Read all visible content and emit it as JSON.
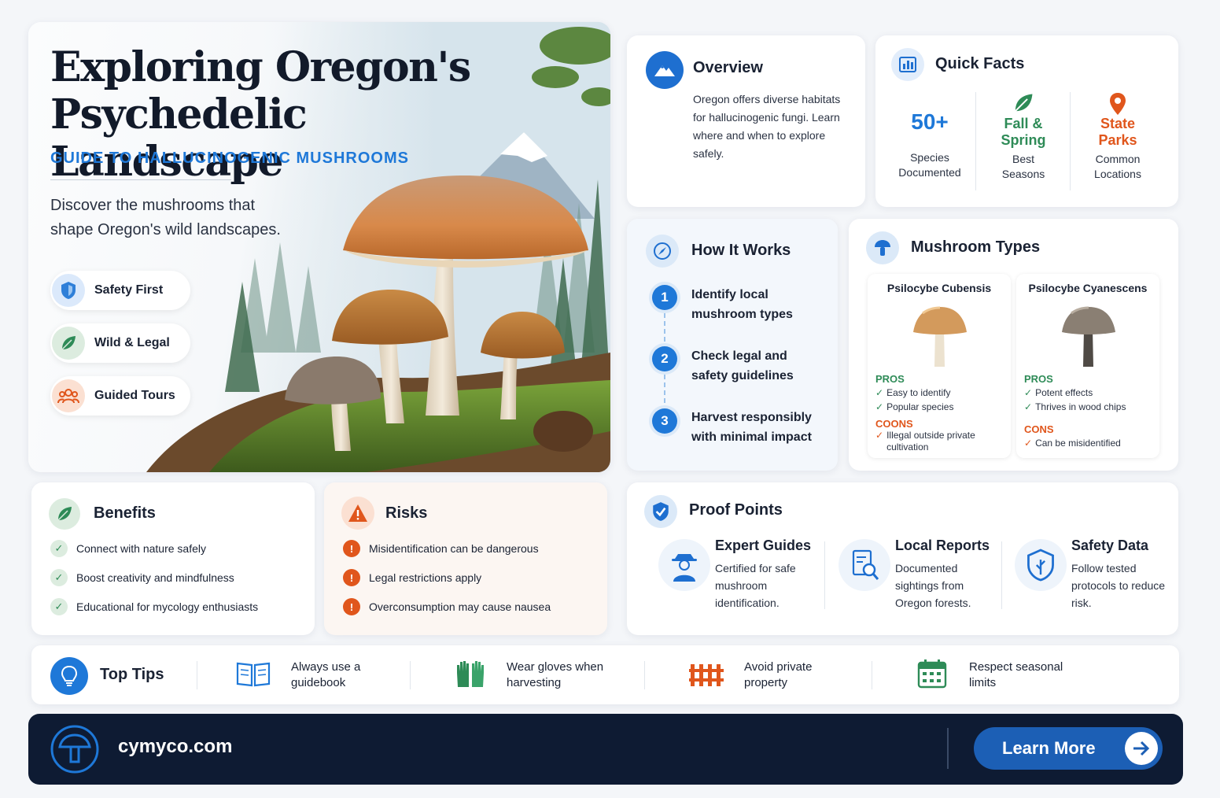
{
  "hero": {
    "title": "Exploring Oregon's Psychedelic Landscape",
    "subtitle": "GUIDE TO HALLUCINOGENIC MUSHROOMS",
    "description": "Discover the mushrooms that shape Oregon's wild landscapes.",
    "pills": [
      {
        "label": "Safety First",
        "icon": "shield-icon",
        "color": "#2f7fd8"
      },
      {
        "label": "Wild & Legal",
        "icon": "leaf-icon",
        "color": "#2e8b57"
      },
      {
        "label": "Guided Tours",
        "icon": "group-icon",
        "color": "#e0561c"
      }
    ]
  },
  "overview": {
    "title": "Overview",
    "icon": "mountain-icon",
    "text": "Oregon offers diverse habitats for hallucinogenic fungi. Learn where and when to explore safely."
  },
  "quick_facts": {
    "title": "Quick Facts",
    "icon": "bar-chart-icon",
    "items": [
      {
        "value": "50+",
        "label": "Species Documented",
        "color": "#1e78d8"
      },
      {
        "value": "Fall & Spring",
        "label": "Best Seasons",
        "icon": "leaf-icon",
        "color": "#2e8b57"
      },
      {
        "value": "State Parks",
        "label": "Common Locations",
        "icon": "map-pin-icon",
        "color": "#e0561c"
      }
    ]
  },
  "how_it_works": {
    "title": "How It Works",
    "icon": "compass-icon",
    "steps": [
      {
        "num": "1",
        "text": "Identify local mushroom types"
      },
      {
        "num": "2",
        "text": "Check legal and safety guidelines"
      },
      {
        "num": "3",
        "text": "Harvest responsibly with minimal impact"
      }
    ]
  },
  "mushroom_types": {
    "title": "Mushroom Types",
    "icon": "mushroom-icon",
    "pros_label": "PROS",
    "cons_label": "CONS",
    "cons_label_alt": "COONS",
    "types": [
      {
        "name": "Psilocybe Cubensis",
        "pros": [
          "Easy to identify",
          "Popular species"
        ],
        "cons": [
          "Illegal outside private cultivation"
        ]
      },
      {
        "name": "Psilocybe Cyanescens",
        "pros": [
          "Potent effects",
          "Thrives in wood chips"
        ],
        "cons": [
          "Can be misidentified"
        ]
      }
    ]
  },
  "benefits": {
    "title": "Benefits",
    "icon": "leaf-icon",
    "items": [
      "Connect with nature safely",
      "Boost creativity and mindfulness",
      "Educational for mycology enthusiasts"
    ]
  },
  "risks": {
    "title": "Risks",
    "icon": "warning-icon",
    "items": [
      "Misidentification can be dangerous",
      "Legal restrictions apply",
      "Overconsumption may cause nausea"
    ]
  },
  "proof_points": {
    "title": "Proof Points",
    "icon": "shield-check-icon",
    "items": [
      {
        "title": "Expert Guides",
        "text": "Certified for safe mushroom identification.",
        "icon": "ranger-icon"
      },
      {
        "title": "Local Reports",
        "text": "Documented sightings from Oregon forests.",
        "icon": "report-search-icon"
      },
      {
        "title": "Safety Data",
        "text": "Follow tested protocols to reduce risk.",
        "icon": "shield-leaf-icon"
      }
    ]
  },
  "top_tips": {
    "title": "Top Tips",
    "icon": "lightbulb-icon",
    "items": [
      {
        "text": "Always use a guidebook",
        "icon": "book-icon"
      },
      {
        "text": "Wear gloves when harvesting",
        "icon": "gloves-icon"
      },
      {
        "text": "Avoid private property",
        "icon": "fence-icon"
      },
      {
        "text": "Respect seasonal limits",
        "icon": "calendar-icon"
      }
    ]
  },
  "footer": {
    "site": "cymyco.com",
    "cta": "Learn More",
    "logo_icon": "mushroom-logo-icon",
    "arrow_icon": "arrow-right-icon"
  },
  "colors": {
    "accent_blue": "#1e78d8",
    "green": "#2e8b57",
    "orange": "#e0561c",
    "navy": "#0e1b33"
  }
}
